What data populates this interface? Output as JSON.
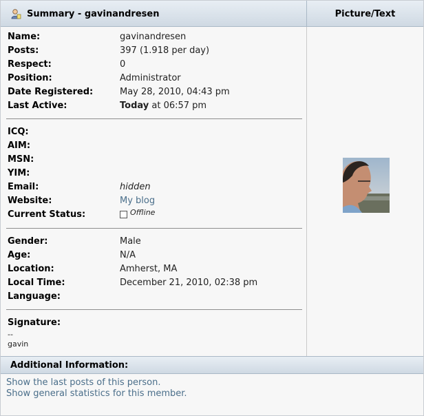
{
  "header": {
    "title": "Summary - gavinandresen",
    "picture_col": "Picture/Text"
  },
  "profile": {
    "name_label": "Name:",
    "name": "gavinandresen",
    "posts_label": "Posts:",
    "posts": "397 (1.918 per day)",
    "respect_label": "Respect:",
    "respect": "0",
    "position_label": "Position:",
    "position": "Administrator",
    "registered_label": "Date Registered:",
    "registered": "May 28, 2010, 04:43 pm",
    "active_label": "Last Active:",
    "active_day": "Today",
    "active_time": " at 06:57 pm",
    "icq_label": "ICQ:",
    "aim_label": "AIM:",
    "msn_label": "MSN:",
    "yim_label": "YIM:",
    "email_label": "Email:",
    "email": "hidden",
    "website_label": "Website:",
    "website": "My blog",
    "status_label": "Current Status:",
    "status": "Offline",
    "gender_label": "Gender:",
    "gender": "Male",
    "age_label": "Age:",
    "age": "N/A",
    "location_label": "Location:",
    "location": "Amherst, MA",
    "localtime_label": "Local Time:",
    "localtime": "December 21, 2010, 02:38 pm",
    "language_label": "Language:",
    "signature_label": "Signature:",
    "signature_line1": "--",
    "signature_line2": "gavin"
  },
  "additional": {
    "title": "Additional Information:",
    "link_posts": "Show the last posts of this person.",
    "link_stats": "Show general statistics for this member."
  },
  "colors": {
    "link": "#4a6e8a",
    "header_bg": "#cfd9e3"
  },
  "icons": {
    "header": "user-icon",
    "status": "offline-checkbox-icon"
  }
}
